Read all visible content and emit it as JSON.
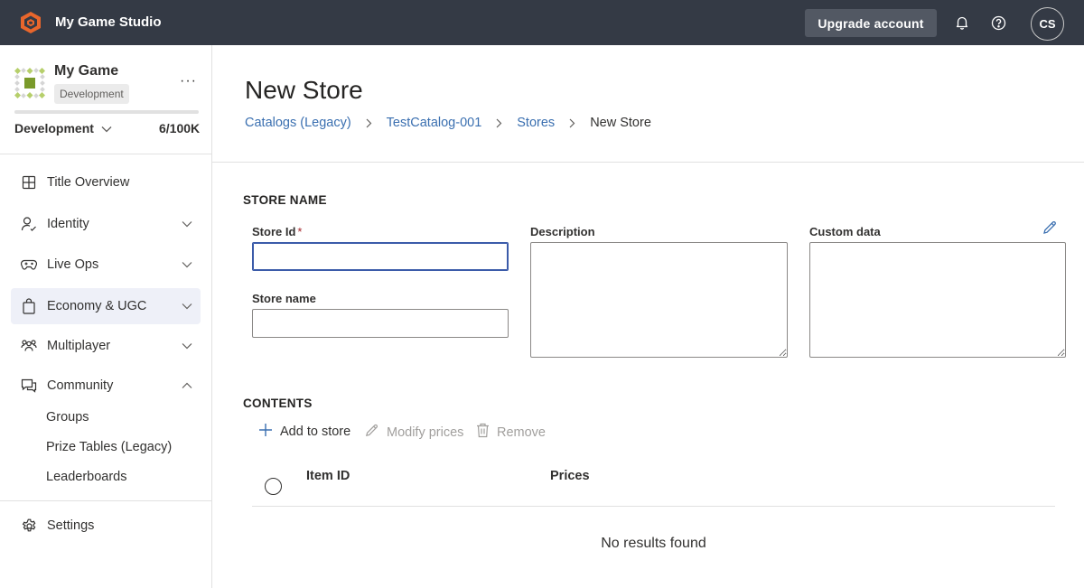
{
  "topbar": {
    "studio_name": "My Game Studio",
    "upgrade_label": "Upgrade account",
    "avatar_initials": "CS",
    "bg_color": "#343a45",
    "logo_color": "#e8662c"
  },
  "sidebar": {
    "game_name": "My Game",
    "env_badge": "Development",
    "env_select": "Development",
    "usage": "6/100K",
    "usage_fraction": 6e-05,
    "more_label": "···",
    "nav": [
      {
        "label": "Title Overview",
        "icon": "grid-icon",
        "expandable": false
      },
      {
        "label": "Identity",
        "icon": "identity-icon",
        "expandable": true,
        "expanded": false
      },
      {
        "label": "Live Ops",
        "icon": "gamepad-icon",
        "expandable": true,
        "expanded": false
      },
      {
        "label": "Economy & UGC",
        "icon": "shopping-bag-icon",
        "expandable": true,
        "expanded": false,
        "active": true
      },
      {
        "label": "Multiplayer",
        "icon": "people-icon",
        "expandable": true,
        "expanded": false
      },
      {
        "label": "Community",
        "icon": "chat-icon",
        "expandable": true,
        "expanded": true
      }
    ],
    "community_items": [
      "Groups",
      "Prize Tables (Legacy)",
      "Leaderboards"
    ],
    "settings_label": "Settings"
  },
  "main": {
    "title": "New Store",
    "breadcrumb": [
      "Catalogs (Legacy)",
      "TestCatalog-001",
      "Stores",
      "New Store"
    ],
    "store_name_section": "STORE NAME",
    "fields": {
      "store_id_label": "Store Id",
      "required_mark": "*",
      "store_id_value": "",
      "store_name_label": "Store name",
      "store_name_value": "",
      "description_label": "Description",
      "description_value": "",
      "custom_data_label": "Custom data",
      "custom_data_value": ""
    },
    "contents_section": "CONTENTS",
    "commands": {
      "add": "Add to store",
      "modify": "Modify prices",
      "remove": "Remove"
    },
    "table": {
      "columns": [
        "Item ID",
        "Prices"
      ],
      "empty_message": "No results found"
    }
  }
}
